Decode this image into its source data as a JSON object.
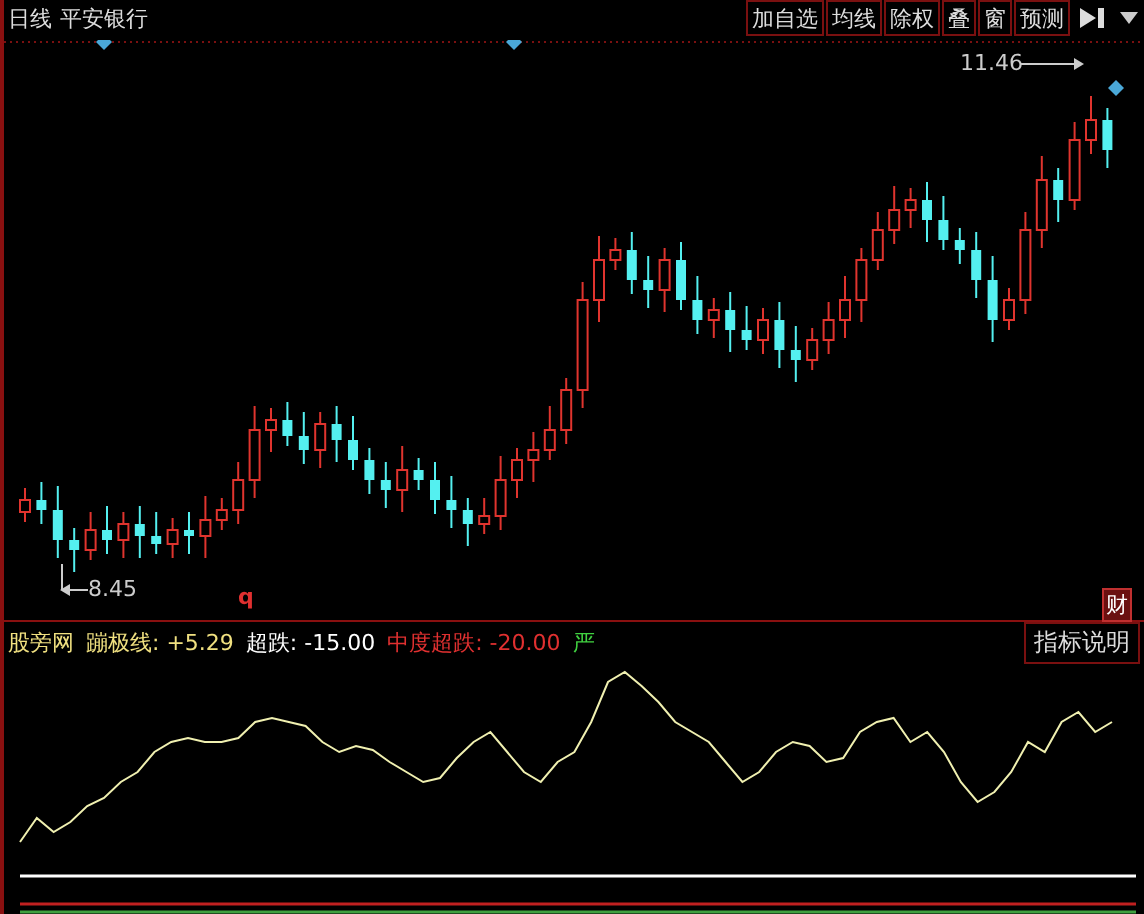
{
  "header": {
    "period": "日线",
    "stock": "平安银行"
  },
  "toolbar": [
    {
      "label": "加自选"
    },
    {
      "label": "均线"
    },
    {
      "label": "除权"
    },
    {
      "label": "叠"
    },
    {
      "label": "窗"
    },
    {
      "label": "预测"
    }
  ],
  "price_chart": {
    "high_label": "11.46",
    "low_label": "8.45",
    "marker": "q",
    "badge": "财"
  },
  "indicator": {
    "name": "股旁网",
    "values": [
      {
        "label": "蹦极线:",
        "value": "+5.29",
        "kind": "line"
      },
      {
        "label": "超跌:",
        "value": "-15.00",
        "kind": "threshold"
      },
      {
        "label": "中度超跌:",
        "value": "-20.00",
        "kind": "alert"
      }
    ],
    "signal": "严",
    "help_button": "指标说明"
  }
}
